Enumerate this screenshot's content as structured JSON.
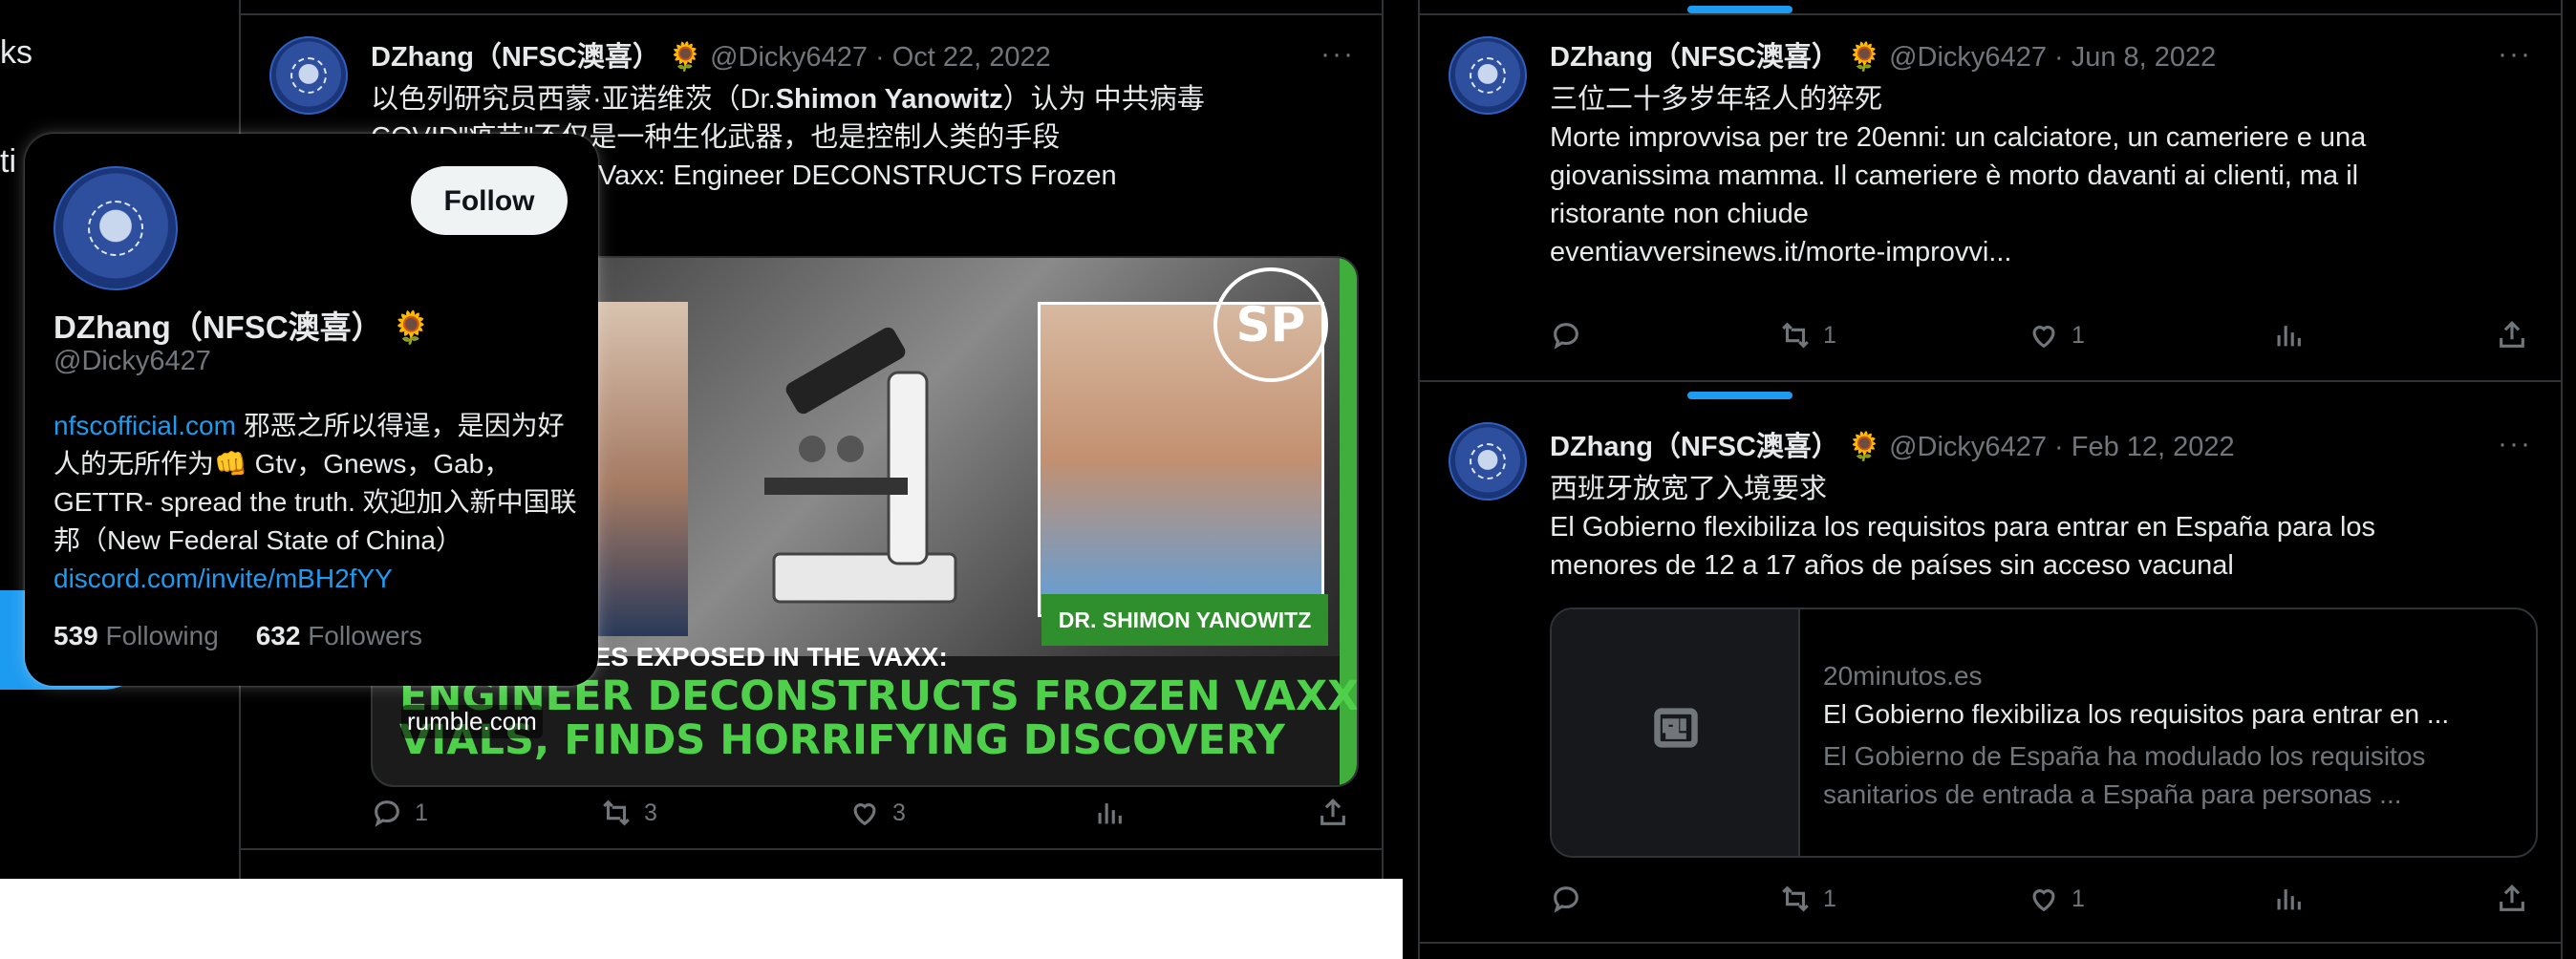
{
  "nav": {
    "fragment_1": "ks",
    "fragment_2": "ti"
  },
  "hover_card": {
    "follow_label": "Follow",
    "name": "DZhang（NFSC澳喜）",
    "emoji": "🌻",
    "handle": "@Dicky6427",
    "bio_link_1": "nfscofficial.com",
    "bio_text_1": " 邪恶之所以得逞，是因为好人的无所作为👊 Gtv，Gnews，Gab，GETTR- spread the truth. 欢迎加入新中国联邦（New Federal State of China）",
    "bio_link_2": "discord.com/invite/mBH2fYY",
    "following_count": "539",
    "following_label": "Following",
    "followers_count": "632",
    "followers_label": "Followers"
  },
  "tweets": [
    {
      "name": "DZhang（NFSC澳喜）",
      "emoji": "🌻",
      "handle": "@Dicky6427",
      "date": "Oct 22, 2022",
      "more": "···",
      "line_1_pre": "以色列研究员西蒙·亚诺维茨（Dr.",
      "line_1_bold": "Shimon Yanowitz",
      "line_1_post": "）认为 中共病毒",
      "line_2": "COVID\"疫苗\"不仅是一种生化武器，也是控制人类的手段",
      "line_3": "EXPOSED In The Vaxx: Engineer DECONSTRUCTS Frozen",
      "media": {
        "logo": "SP",
        "nameplate": "DR. SHIMON YANOWITZ",
        "headline_1": "URES EXPOSED IN THE VAXX:",
        "headline_2": "ENGINEER DECONSTRUCTS FROZEN VAXX",
        "headline_3": "VIALS, FINDS HORRIFYING DISCOVERY",
        "domain": "rumble.com"
      },
      "replies": "1",
      "retweets": "3",
      "likes": "3"
    },
    {
      "name": "DZhang（NFSC澳喜）",
      "emoji": "🌻",
      "handle": "@Dicky6427",
      "date": "Jun 8, 2022",
      "more": "···",
      "line_1": "三位二十多岁年轻人的猝死",
      "line_2": "Morte improvvisa per tre 20enni: un calciatore, un cameriere e una",
      "line_3": "giovanissima mamma. Il cameriere è morto davanti ai clienti, ma il",
      "line_4": "ristorante non chiude",
      "link": "eventiavversinews.it/morte-improvvi...",
      "replies": "",
      "retweets": "1",
      "likes": "1"
    },
    {
      "name": "DZhang（NFSC澳喜）",
      "emoji": "🌻",
      "handle": "@Dicky6427",
      "date": "Feb 12, 2022",
      "more": "···",
      "line_1": "西班牙放宽了入境要求",
      "line_2": "El Gobierno flexibiliza los requisitos para entrar en España para los",
      "line_3": "menores de 12 a 17 años de países sin acceso vacunal",
      "card": {
        "domain": "20minutos.es",
        "title": "El Gobierno flexibiliza los requisitos para entrar en ...",
        "description": "El Gobierno de España ha modulado los requisitos sanitarios de entrada a España para personas ..."
      },
      "replies": "",
      "retweets": "1",
      "likes": "1"
    }
  ],
  "icons": [
    "reply-icon",
    "retweet-icon",
    "like-icon",
    "views-icon",
    "share-icon",
    "article-icon",
    "more-icon"
  ],
  "colors": {
    "background": "#000000",
    "link": "#1d9bf0",
    "muted": "#71767b",
    "text": "#e7e9ea",
    "follow_button": "#eff3f4"
  }
}
